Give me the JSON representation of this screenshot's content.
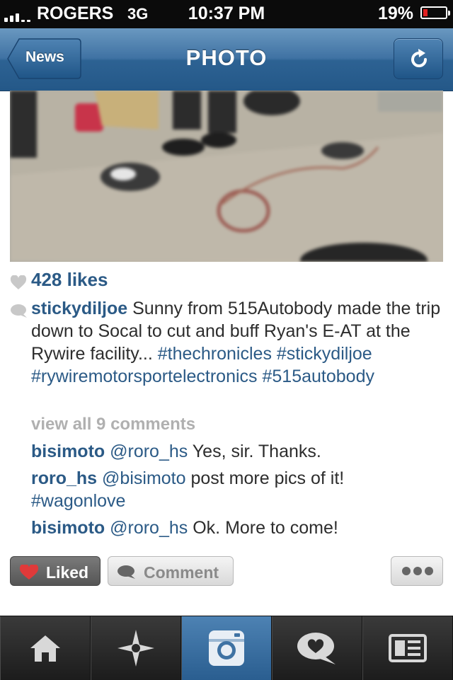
{
  "status_bar": {
    "carrier": "ROGERS",
    "network": "3G",
    "time": "10:37 PM",
    "battery": "19%",
    "battery_level": 0.19
  },
  "nav": {
    "back_label": "News",
    "title": "PHOTO",
    "refresh_icon": "refresh-icon"
  },
  "post": {
    "likes": "428 likes",
    "caption": {
      "username": "stickydiljoe",
      "text": "Sunny from 515Autobody made the trip down to Socal to cut and buff Ryan's E-AT at the Rywire facility...",
      "tags": [
        "#thechronicles",
        "#stickydiljoe",
        "#rywiremotorsportelectronics",
        "#515autobody"
      ]
    },
    "view_all": "view all 9 comments",
    "comments": [
      {
        "user": "bisimoto",
        "mention": "@roro_hs",
        "text": "Yes, sir. Thanks.",
        "extra": ""
      },
      {
        "user": "roro_hs",
        "mention": "@bisimoto",
        "text": "post more pics of it!",
        "extra": "#wagonlove"
      },
      {
        "user": "bisimoto",
        "mention": "@roro_hs",
        "text": "Ok. More to come!",
        "extra": ""
      }
    ]
  },
  "actions": {
    "liked_label": "Liked",
    "comment_label": "Comment",
    "more_icon": "more-icon"
  },
  "tabs": [
    {
      "icon": "home-icon"
    },
    {
      "icon": "explore-icon"
    },
    {
      "icon": "camera-icon",
      "active": true
    },
    {
      "icon": "news-icon"
    },
    {
      "icon": "profile-icon"
    }
  ],
  "colors": {
    "accent": "#2b5a86",
    "nav_bar": "#3f72a3",
    "liked_heart": "#e03a3a"
  }
}
